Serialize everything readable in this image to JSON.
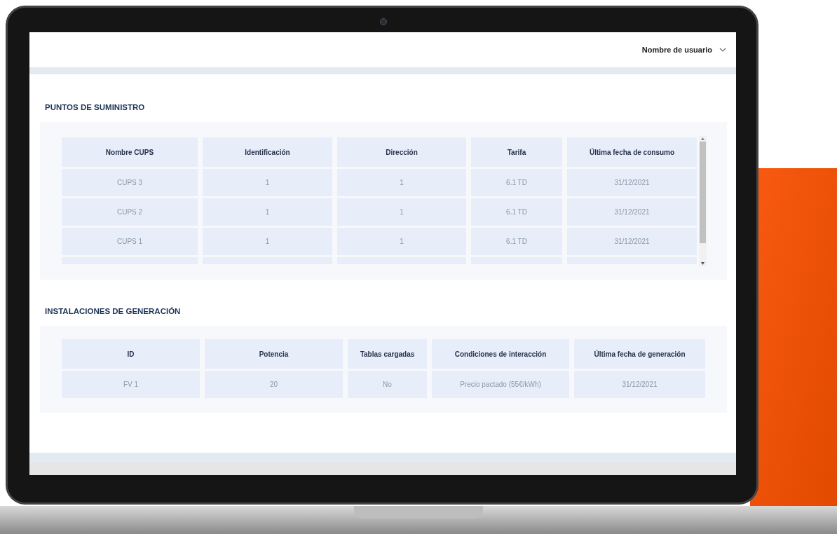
{
  "top_bar": {
    "user_menu": "Nombre de usuario"
  },
  "sections": [
    {
      "title": "PUNTOS DE SUMINISTRO",
      "scrollable": true,
      "columns": [
        "Nombre CUPS",
        "Identificación",
        "Dirección",
        "Tarifa",
        "Última fecha de consumo"
      ],
      "rows": [
        [
          "CUPS 3",
          "1",
          "1",
          "6.1 TD",
          "31/12/2021"
        ],
        [
          "CUPS 2",
          "1",
          "1",
          "6.1 TD",
          "31/12/2021"
        ],
        [
          "CUPS 1",
          "1",
          "1",
          "6.1 TD",
          "31/12/2021"
        ]
      ]
    },
    {
      "title": "INSTALACIONES DE GENERACIÓN",
      "scrollable": false,
      "columns": [
        "ID",
        "Potencia",
        "Tablas cargadas",
        "Condiciones de interacción",
        "Última fecha de generación"
      ],
      "rows": [
        [
          "FV 1",
          "20",
          "No",
          "Precio pactado (55€/kWh)",
          "31/12/2021"
        ]
      ]
    }
  ]
}
